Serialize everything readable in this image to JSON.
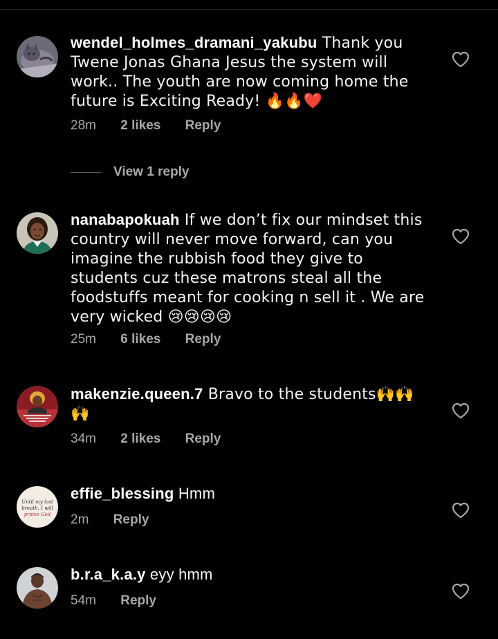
{
  "comments": [
    {
      "username": "wendel_holmes_dramani_yakubu",
      "text": " Thank you Twene Jonas Ghana Jesus the system will work.. The youth are now coming home the future is Exciting Ready! 🔥🔥❤️",
      "time": "28m",
      "likes": "2 likes",
      "reply": "Reply",
      "avatar": "cat-avatar"
    },
    {
      "username": "nanabapokuah",
      "text": " If we don’t fix our mindset this country will never move forward, can you imagine the rubbish food they give to students cuz these matrons steal all the foodstuffs meant for cooking n sell it . We are very wicked 😢😢😢😢",
      "time": "25m",
      "likes": "6 likes",
      "reply": "Reply",
      "avatar": "woman-avatar"
    },
    {
      "username": "makenzie.queen.7",
      "text": " Bravo to the students🙌🙌🙌",
      "time": "34m",
      "likes": "2 likes",
      "reply": "Reply",
      "avatar": "poster-avatar"
    },
    {
      "username": "effie_blessing",
      "text": " Hmm",
      "time": "2m",
      "reply": "Reply",
      "avatar": "quote-avatar",
      "avatar_text": [
        "Until my last",
        "breath, I will",
        "praise God"
      ]
    },
    {
      "username": "b.r.a_k.a.y",
      "text": " eyy hmm",
      "time": "54m",
      "reply": "Reply",
      "avatar": "man-avatar"
    }
  ],
  "view_replies": "View 1 reply",
  "colors": {
    "background": "#000000",
    "text": "#f5f5f5",
    "meta": "#a8a8a8",
    "heart": "#a8a8a8"
  }
}
